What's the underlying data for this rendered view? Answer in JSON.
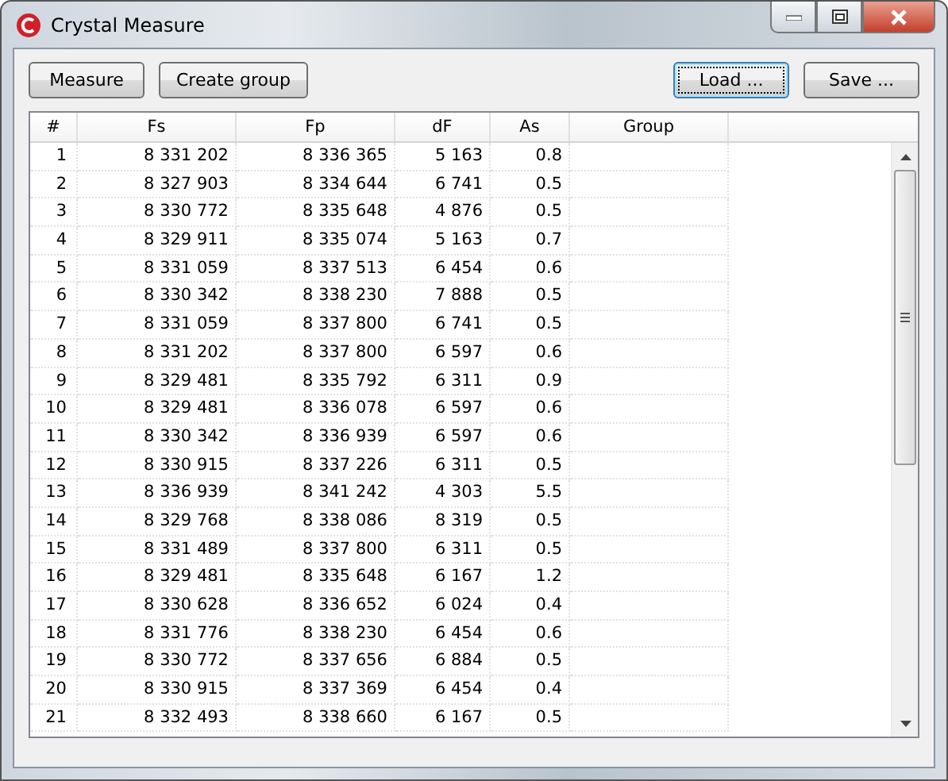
{
  "window": {
    "title": "Crystal Measure"
  },
  "toolbar": {
    "left": [
      {
        "label": "Measure",
        "focused": false
      },
      {
        "label": "Create group",
        "focused": false
      }
    ],
    "right": [
      {
        "label": "Load ...",
        "focused": true
      },
      {
        "label": "Save ...",
        "focused": false
      }
    ]
  },
  "table": {
    "columns": [
      "#",
      "Fs",
      "Fp",
      "dF",
      "As",
      "Group"
    ],
    "rows": [
      [
        "1",
        "8 331 202",
        "8 336 365",
        "5 163",
        "0.8"
      ],
      [
        "2",
        "8 327 903",
        "8 334 644",
        "6 741",
        "0.5"
      ],
      [
        "3",
        "8 330 772",
        "8 335 648",
        "4 876",
        "0.5"
      ],
      [
        "4",
        "8 329 911",
        "8 335 074",
        "5 163",
        "0.7"
      ],
      [
        "5",
        "8 331 059",
        "8 337 513",
        "6 454",
        "0.6"
      ],
      [
        "6",
        "8 330 342",
        "8 338 230",
        "7 888",
        "0.5"
      ],
      [
        "7",
        "8 331 059",
        "8 337 800",
        "6 741",
        "0.5"
      ],
      [
        "8",
        "8 331 202",
        "8 337 800",
        "6 597",
        "0.6"
      ],
      [
        "9",
        "8 329 481",
        "8 335 792",
        "6 311",
        "0.9"
      ],
      [
        "10",
        "8 329 481",
        "8 336 078",
        "6 597",
        "0.6"
      ],
      [
        "11",
        "8 330 342",
        "8 336 939",
        "6 597",
        "0.6"
      ],
      [
        "12",
        "8 330 915",
        "8 337 226",
        "6 311",
        "0.5"
      ],
      [
        "13",
        "8 336 939",
        "8 341 242",
        "4 303",
        "5.5"
      ],
      [
        "14",
        "8 329 768",
        "8 338 086",
        "8 319",
        "0.5"
      ],
      [
        "15",
        "8 331 489",
        "8 337 800",
        "6 311",
        "0.5"
      ],
      [
        "16",
        "8 329 481",
        "8 335 648",
        "6 167",
        "1.2"
      ],
      [
        "17",
        "8 330 628",
        "8 336 652",
        "6 024",
        "0.4"
      ],
      [
        "18",
        "8 331 776",
        "8 338 230",
        "6 454",
        "0.6"
      ],
      [
        "19",
        "8 330 772",
        "8 337 656",
        "6 884",
        "0.5"
      ],
      [
        "20",
        "8 330 915",
        "8 337 369",
        "6 454",
        "0.4"
      ],
      [
        "21",
        "8 332 493",
        "8 338 660",
        "6 167",
        "0.5"
      ]
    ]
  }
}
